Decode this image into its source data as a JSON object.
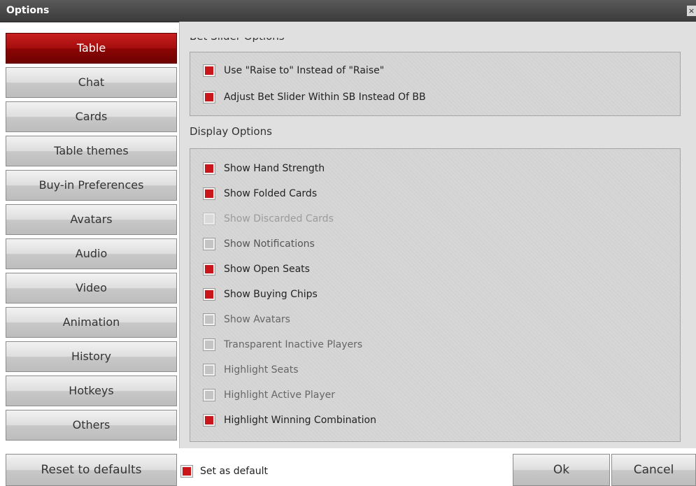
{
  "window": {
    "title": "Options",
    "close_glyph": "×"
  },
  "nav": {
    "items": [
      {
        "label": "Table",
        "active": true
      },
      {
        "label": "Chat"
      },
      {
        "label": "Cards"
      },
      {
        "label": "Table themes"
      },
      {
        "label": "Buy-in Preferences"
      },
      {
        "label": "Avatars"
      },
      {
        "label": "Audio"
      },
      {
        "label": "Video"
      },
      {
        "label": "Animation"
      },
      {
        "label": "History"
      },
      {
        "label": "Hotkeys"
      },
      {
        "label": "Others"
      }
    ],
    "reset_label": "Reset to defaults"
  },
  "bet_slider": {
    "title": "Bet Slider Options",
    "options": [
      {
        "label": "Use \"Raise to\" Instead of \"Raise\"",
        "checked": true
      },
      {
        "label": "Adjust Bet Slider Within SB Instead Of BB",
        "checked": true
      }
    ]
  },
  "display": {
    "title": "Display Options",
    "options": [
      {
        "label": "Show Hand Strength",
        "checked": true
      },
      {
        "label": "Show Folded Cards",
        "checked": true
      },
      {
        "label": "Show Discarded Cards",
        "checked": false,
        "disabled": true
      },
      {
        "label": "Show Notifications",
        "checked": false
      },
      {
        "label": "Show Open Seats",
        "checked": true
      },
      {
        "label": "Show Buying Chips",
        "checked": true
      },
      {
        "label": "Show Avatars",
        "checked": false
      },
      {
        "label": "Transparent Inactive Players",
        "checked": false
      },
      {
        "label": "Highlight Seats",
        "checked": false
      },
      {
        "label": "Highlight Active Player",
        "checked": false
      },
      {
        "label": "Highlight Winning Combination",
        "checked": true
      }
    ]
  },
  "footer": {
    "set_default_label": "Set as default",
    "set_default_checked": true,
    "ok_label": "Ok",
    "cancel_label": "Cancel"
  },
  "colors": {
    "accent": "#c8161b",
    "active_tab": "#a50d0d",
    "titlebar": "#4a4a4a"
  }
}
